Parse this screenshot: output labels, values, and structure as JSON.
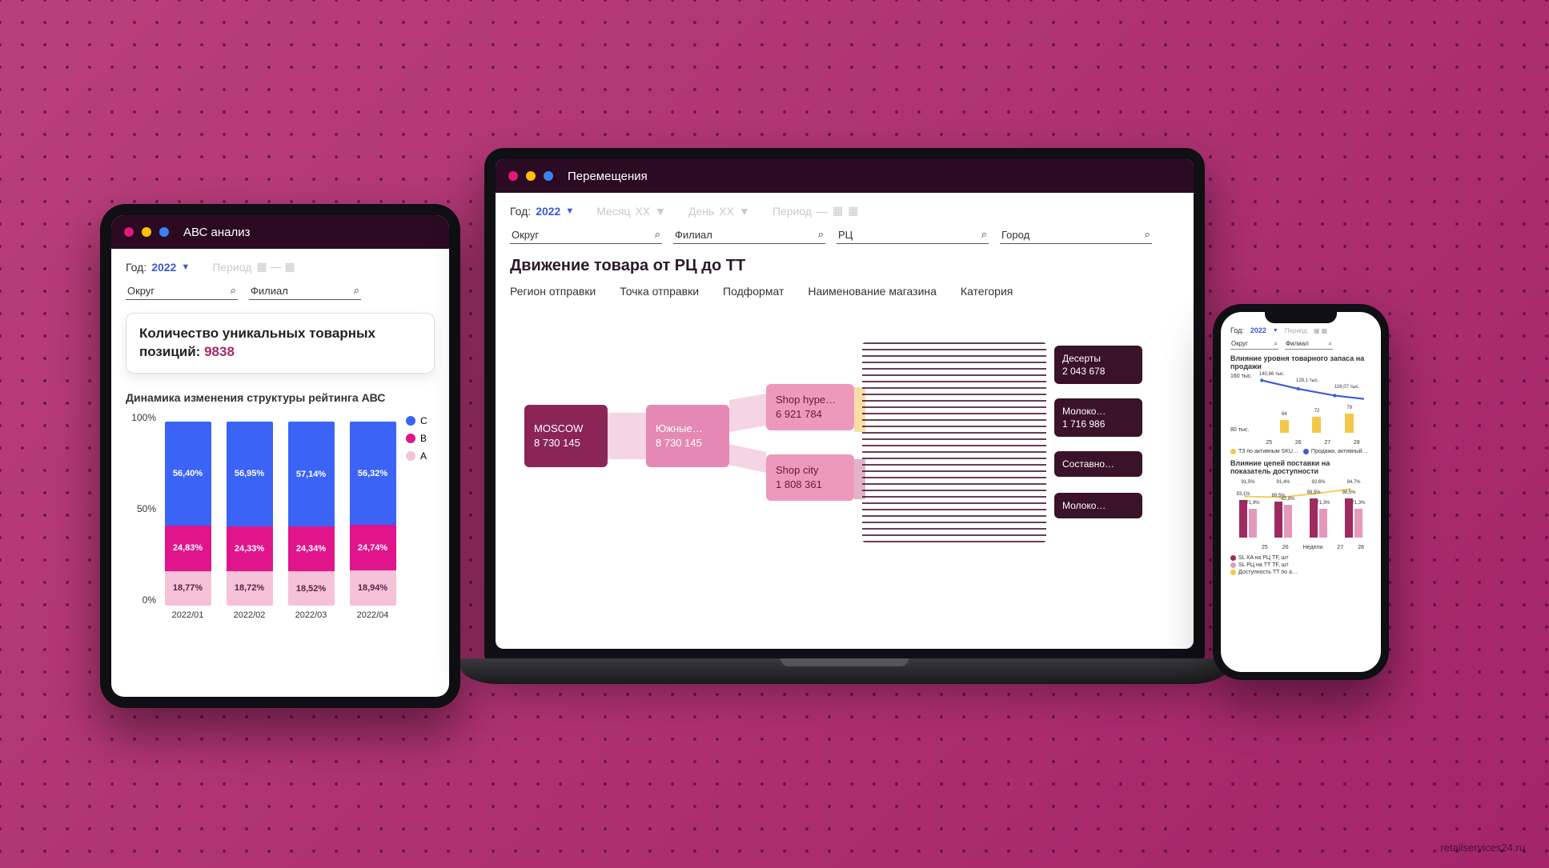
{
  "footer_link": "retailservices24.ru",
  "tablet": {
    "title": "АВС анализ",
    "filters": {
      "year_label": "Год:",
      "year_value": "2022",
      "period_label": "Период",
      "search1": "Округ",
      "search2": "Филиал"
    },
    "callout_prefix": "Количество уникальных товарных позиций: ",
    "callout_value": "9838",
    "chart_title": "Динамика изменения структуры рейтинга АВС",
    "legend": {
      "c": "C",
      "b": "B",
      "a": "A"
    },
    "yaxis": [
      "100%",
      "50%",
      "0%"
    ]
  },
  "laptop": {
    "title": "Перемещения",
    "filters": {
      "year_label": "Год:",
      "year_value": "2022",
      "month_label": "Месяц",
      "month_val": "ХХ",
      "day_label": "День",
      "day_val": "ХХ",
      "period_label": "Период",
      "period_val": "—",
      "s1": "Округ",
      "s2": "Филиал",
      "s3": "РЦ",
      "s4": "Город"
    },
    "section_title": "Движение товара от РЦ до ТТ",
    "sankey_headers": [
      "Регион отправки",
      "Точка отправки",
      "Подформат",
      "Наименование магазина",
      "Категория"
    ],
    "nodes": {
      "root_name": "MOSCOW",
      "root_val": "8 730 145",
      "mid_name": "Южные…",
      "mid_val": "8 730 145",
      "shop1_name": "Shop hype…",
      "shop1_val": "6 921 784",
      "shop2_name": "Shop city",
      "shop2_val": "1 808 361"
    },
    "categories": [
      {
        "name": "Десерты",
        "val": "2 043 678"
      },
      {
        "name": "Молоко…",
        "val": "1 716 986"
      },
      {
        "name": "Составно…",
        "val": ""
      },
      {
        "name": "Молоко…",
        "val": ""
      }
    ]
  },
  "phone": {
    "year_label": "Год:",
    "year_value": "2022",
    "period_label": "Период",
    "s1": "Округ",
    "s2": "Филиал",
    "chart1_title": "Влияние уровня товарного запаса на продажи",
    "chart1_yaxis": [
      "160 тыс.",
      "80 тыс."
    ],
    "chart1_line_vals": [
      "140,86 тыс.",
      "128,1 тыс.",
      "116,07 тыс."
    ],
    "chart1_bar_vals": [
      "64",
      "72",
      "79"
    ],
    "chart1_cats": [
      "25",
      "26",
      "27",
      "28"
    ],
    "chart1_leg1": "ТЗ по активным SKU…",
    "chart1_leg2": "Продажи, активный…",
    "chart2_title": "Влияние цепей поставки на показатель доступности",
    "chart2_line_vals": [
      "91,5%",
      "91,4%",
      "92,6%",
      "94,7%"
    ],
    "chart2_bars": [
      {
        "a": "93,1%",
        "b": "71,9%"
      },
      {
        "a": "89,5%",
        "b": "82,8%"
      },
      {
        "a": "98,5%",
        "b": "71,3%"
      },
      {
        "a": "98,5%",
        "b": "71,3%"
      }
    ],
    "chart2_cats_label": "Недели",
    "chart2_cats": [
      "25",
      "26",
      "27",
      "28"
    ],
    "chart2_leg": [
      "SL КA на РЦ TF, шт",
      "SL РЦ на ТТ TF, шт",
      "Доступность ТТ по а…"
    ]
  },
  "chart_data": [
    {
      "id": "abc_stacked",
      "type": "bar",
      "stacked_percent": true,
      "title": "Динамика изменения структуры рейтинга АВС",
      "categories": [
        "2022/01",
        "2022/02",
        "2022/03",
        "2022/04"
      ],
      "series": [
        {
          "name": "A",
          "values": [
            18.77,
            18.72,
            18.52,
            18.94
          ],
          "color": "#f5c2d9"
        },
        {
          "name": "B",
          "values": [
            24.83,
            24.33,
            24.34,
            24.74
          ],
          "color": "#e0148b"
        },
        {
          "name": "C",
          "values": [
            56.4,
            56.95,
            57.14,
            56.32
          ],
          "color": "#3b63f6"
        }
      ],
      "ylabel": "%",
      "ylim": [
        0,
        100
      ]
    },
    {
      "id": "phone_line_bar",
      "type": "combo",
      "title": "Влияние уровня товарного запаса на продажи",
      "x": [
        25,
        26,
        27,
        28
      ],
      "series": [
        {
          "name": "Продажи, активный…",
          "type": "line",
          "values": [
            140.86,
            128.1,
            116.07,
            null
          ],
          "unit": "тыс.",
          "color": "#3b57d9"
        },
        {
          "name": "ТЗ по активным SKU…",
          "type": "bar",
          "values": [
            null,
            64,
            72,
            79
          ],
          "color": "#f3c84a"
        }
      ],
      "ylim": [
        0,
        160
      ]
    },
    {
      "id": "phone_availability",
      "type": "combo",
      "title": "Влияние цепей поставки на показатель доступности",
      "x": [
        25,
        26,
        27,
        28
      ],
      "xlabel": "Недели",
      "series": [
        {
          "name": "SL КA на РЦ TF, шт",
          "type": "bar",
          "values": [
            93.1,
            89.5,
            98.5,
            98.5
          ],
          "color": "#9e2a60"
        },
        {
          "name": "SL РЦ на ТТ TF, шт",
          "type": "bar",
          "values": [
            71.9,
            82.8,
            71.3,
            71.3
          ],
          "color": "#e499bb"
        },
        {
          "name": "Доступность ТТ по а…",
          "type": "line",
          "values": [
            91.5,
            91.4,
            92.6,
            94.7
          ],
          "color": "#f3c84a"
        }
      ],
      "ylim": [
        0,
        100
      ],
      "unit": "%"
    },
    {
      "id": "sankey",
      "type": "sankey",
      "title": "Движение товара от РЦ до ТТ",
      "levels": [
        "Регион отправки",
        "Точка отправки",
        "Подформат",
        "Наименование магазина",
        "Категория"
      ],
      "nodes": [
        {
          "level": 0,
          "name": "MOSCOW",
          "value": 8730145
        },
        {
          "level": 1,
          "name": "Южные…",
          "value": 8730145
        },
        {
          "level": 2,
          "name": "Shop hype…",
          "value": 6921784
        },
        {
          "level": 2,
          "name": "Shop city",
          "value": 1808361
        },
        {
          "level": 4,
          "name": "Десерты",
          "value": 2043678
        },
        {
          "level": 4,
          "name": "Молоко…",
          "value": 1716986
        },
        {
          "level": 4,
          "name": "Составно…",
          "value": null
        },
        {
          "level": 4,
          "name": "Молоко…",
          "value": null
        }
      ]
    }
  ]
}
